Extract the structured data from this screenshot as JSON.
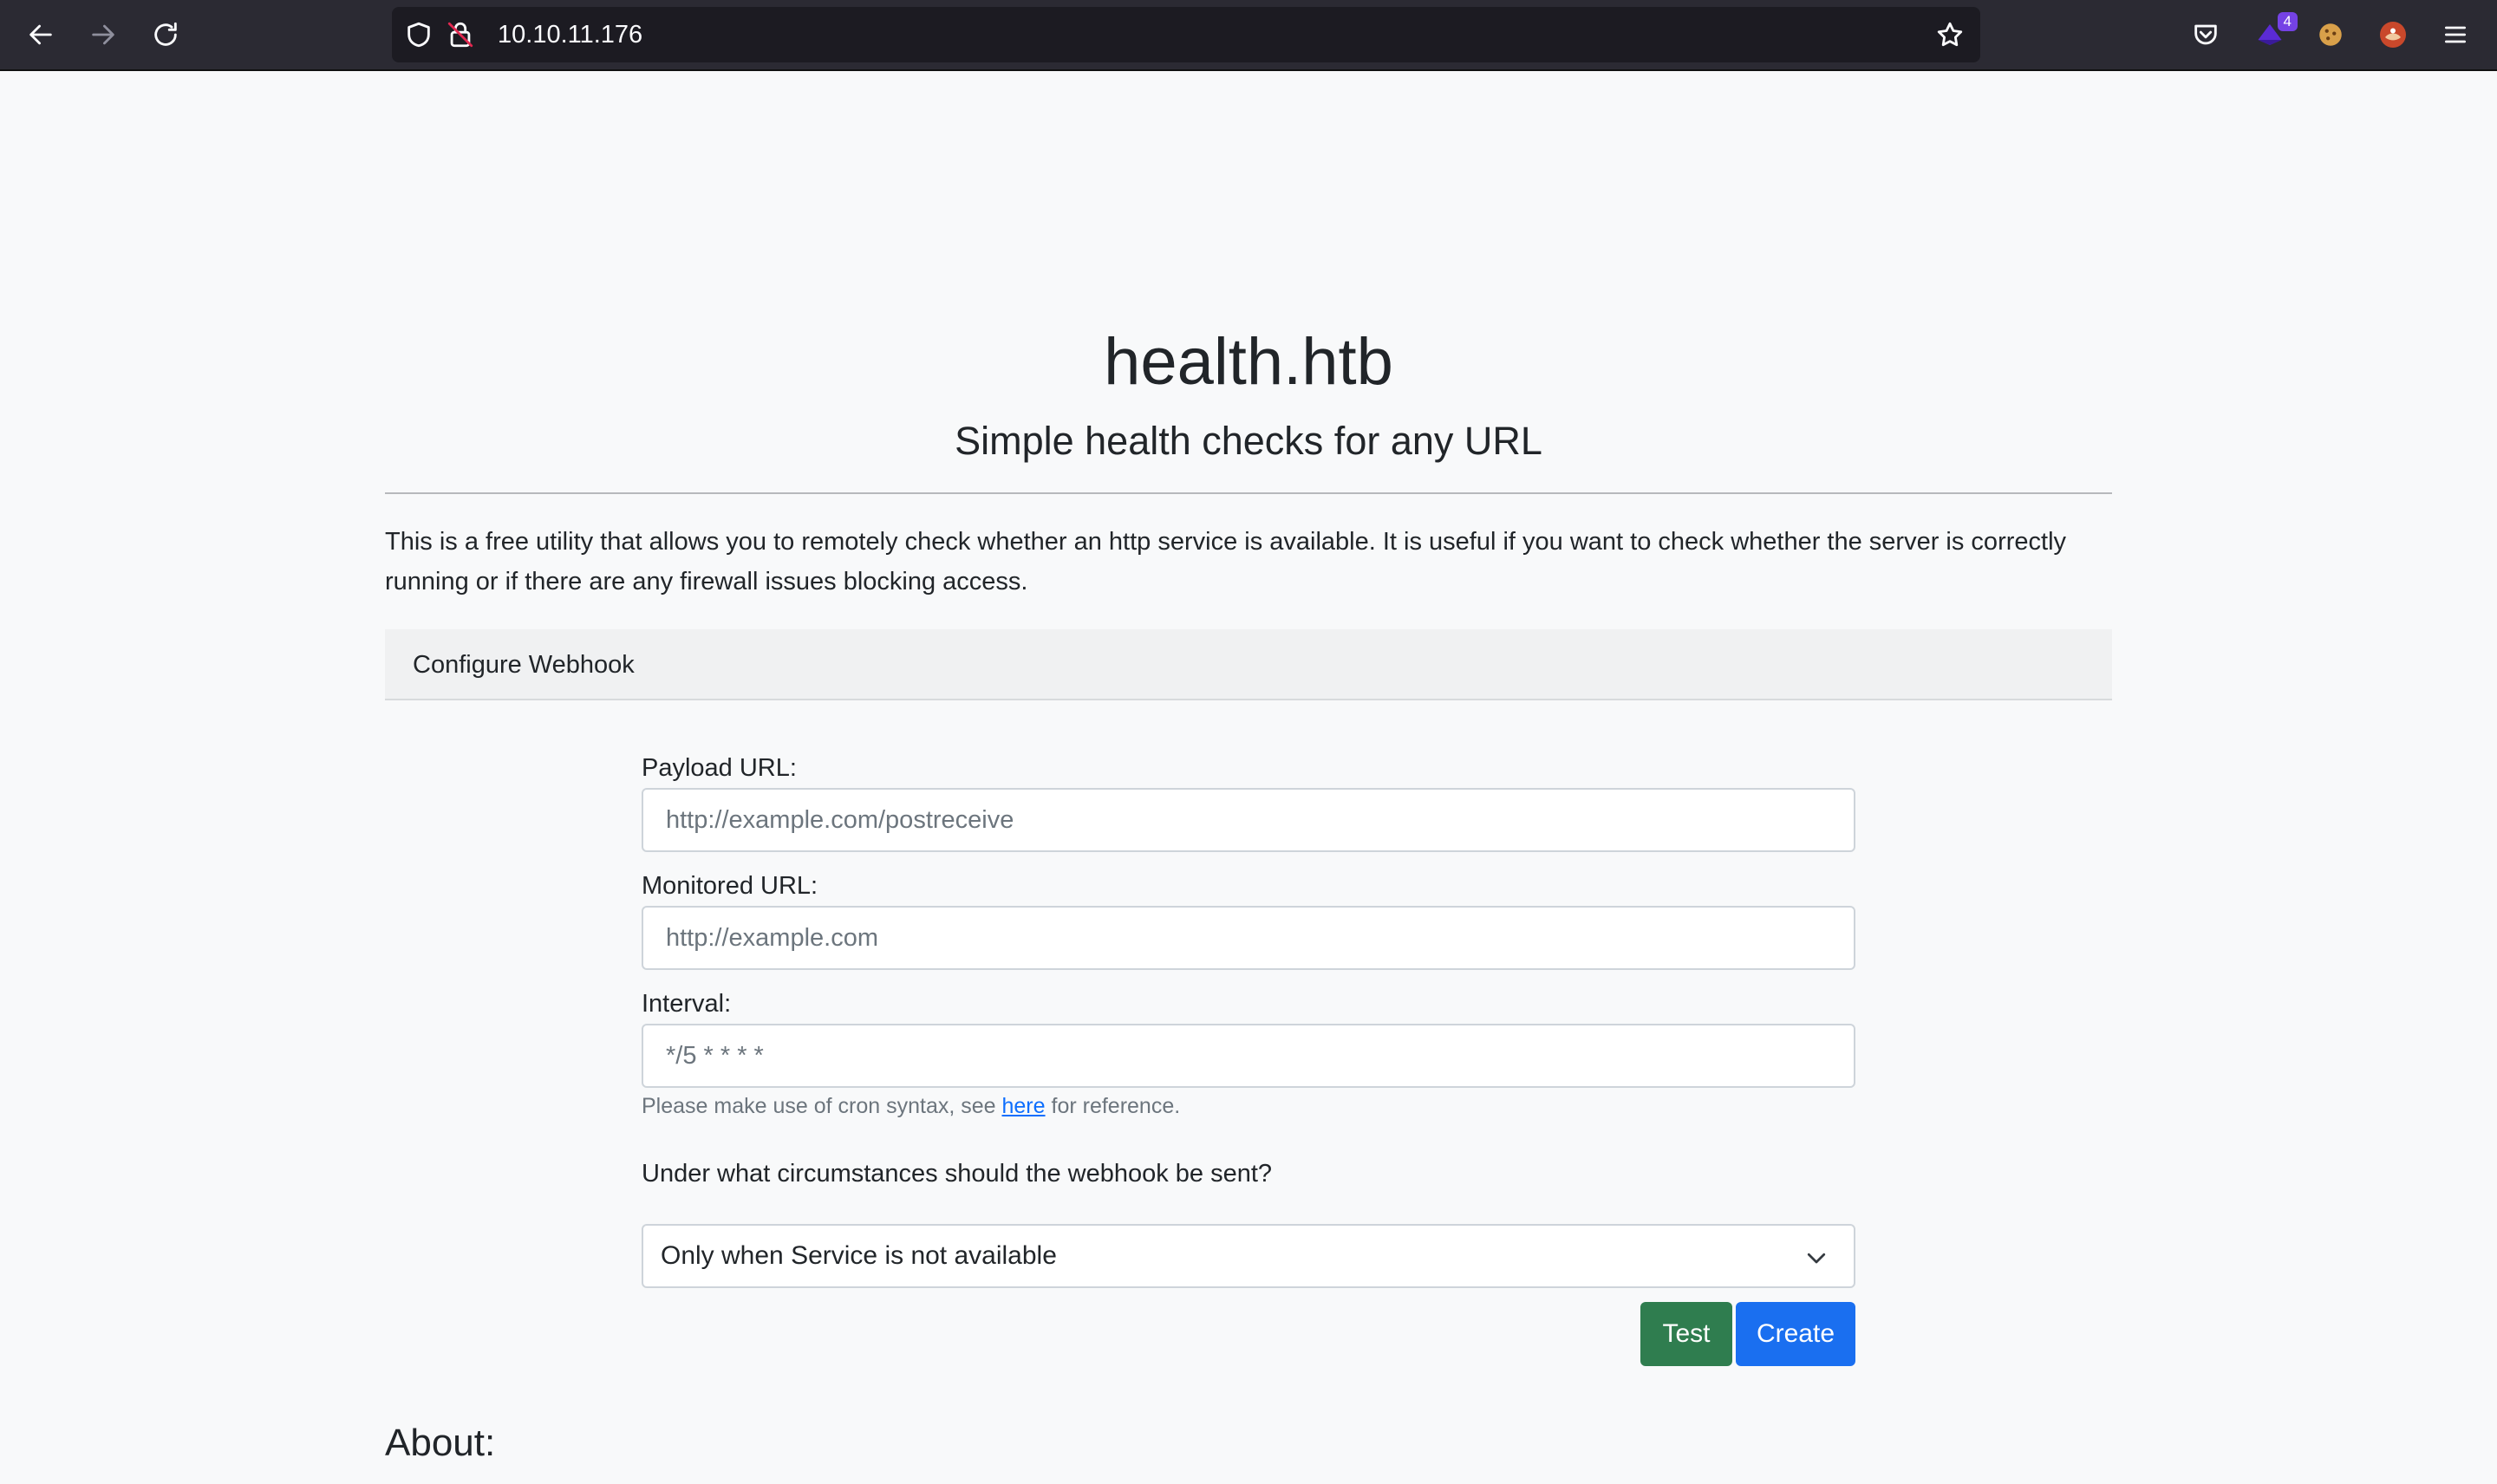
{
  "browser": {
    "url": "10.10.11.176",
    "extension_badge": "4"
  },
  "page": {
    "title": "health.htb",
    "subtitle": "Simple health checks for any URL",
    "intro": "This is a free utility that allows you to remotely check whether an http service is available. It is useful if you want to check whether the server is correctly running or if there are any firewall issues blocking access.",
    "card_title": "Configure Webhook",
    "form": {
      "payload_label": "Payload URL:",
      "payload_placeholder": "http://example.com/postreceive",
      "monitored_label": "Monitored URL:",
      "monitored_placeholder": "http://example.com",
      "interval_label": "Interval:",
      "interval_placeholder": "*/5 * * * *",
      "help_prefix": "Please make use of cron syntax, see ",
      "help_link": "here",
      "help_suffix": " for reference.",
      "question": "Under what circumstances should the webhook be sent?",
      "select_value": "Only when Service is not available",
      "test_button": "Test",
      "create_button": "Create"
    },
    "about_heading": "About:"
  },
  "colors": {
    "toolbar": "#2b2a33",
    "urlbar": "#1c1b22",
    "test_button": "#2f7d4f",
    "create_button": "#1a6ff0",
    "link": "#0d6efd"
  }
}
